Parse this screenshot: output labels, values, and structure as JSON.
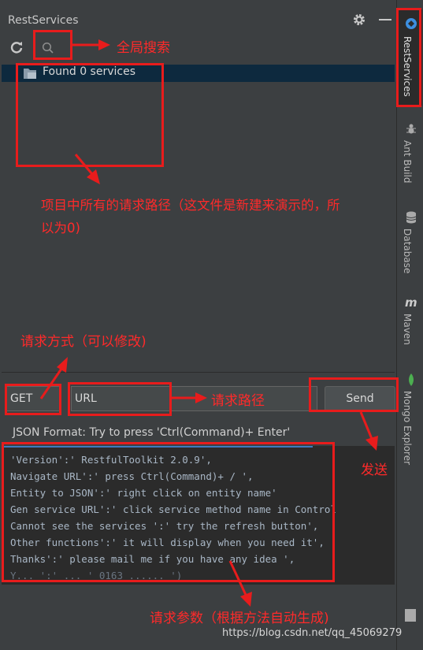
{
  "panel": {
    "title": "RestServices"
  },
  "tree": {
    "root_label": "Found 0 services"
  },
  "request": {
    "method": "GET",
    "url_placeholder": "URL",
    "send_label": "Send"
  },
  "json_format_label": "JSON Format: Try to press 'Ctrl(Command)+ Enter'",
  "json_lines": [
    "'Version':' RestfulToolkit 2.0.9',",
    "Navigate URL':' press Ctrl(Command)+ / ',",
    "Entity to JSON':' right click on entity name'",
    "Gen service URL':' click service method name in Control",
    "Cannot see the services ':' try the refresh button',",
    "Other functions':' it will display when you need it',",
    "Thanks':' please mail me if you have any idea ',",
    "Y... ':' ... ' 0163 ...... ')"
  ],
  "right_tabs": [
    "RestServices",
    "Ant Build",
    "Database",
    "Maven",
    "Mongo Explorer"
  ],
  "annotations": {
    "global_search": "全局搜索",
    "all_paths_line1": "项目中所有的请求路径（这文件是新建来演示的，所",
    "all_paths_line2": "以为0)",
    "method_note": "请求方式（可以修改)",
    "path_note": "请求路径",
    "send_note": "发送",
    "params_note": "请求参数（根据方法自动生成)"
  },
  "watermark": "https://blog.csdn.net/qq_45069279",
  "colors": {
    "annotation": "#e81c1c",
    "panel_bg": "#3c3f41",
    "editor_bg": "#2b2b2b",
    "selection": "#0d293e"
  }
}
